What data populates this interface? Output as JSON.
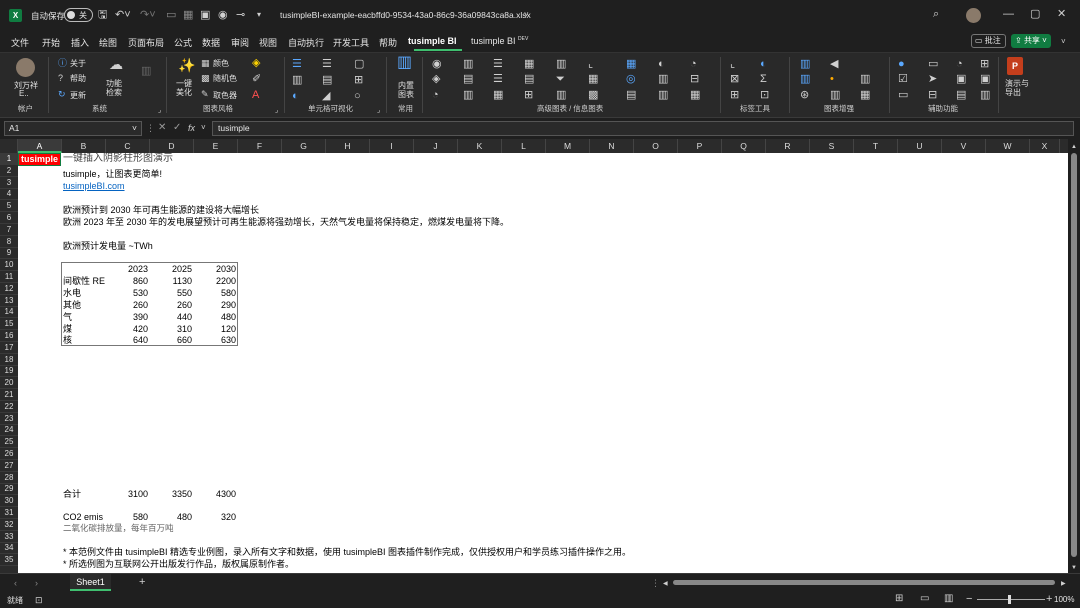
{
  "titlebar": {
    "autosave": "自动保存",
    "autosave_state": "关",
    "filename": "tusimpleBI-example-eacbffd0-9534-43a0-86c9-36a09843ca8a.xlsx"
  },
  "tabs": [
    "文件",
    "开始",
    "插入",
    "绘图",
    "页面布局",
    "公式",
    "数据",
    "审阅",
    "视图",
    "自动执行",
    "开发工具",
    "帮助",
    "tusimple BI",
    "tusimple BI"
  ],
  "tab_dev_badge": "DEV",
  "right_buttons": {
    "comments": "批注",
    "share": "共享"
  },
  "ribbon": {
    "account": {
      "user": "刘万祥",
      "user2": "E..",
      "group": "帐户"
    },
    "system": {
      "about": "关于",
      "help": "帮助",
      "update": "更新",
      "func": "功能",
      "func2": "检索",
      "group": "系统"
    },
    "style": {
      "beautify": "一键",
      "beautify2": "美化",
      "color": "颜色",
      "random": "随机色",
      "pick": "取色器",
      "group": "图表风格"
    },
    "cellviz": {
      "group": "单元格可视化"
    },
    "common": {
      "builtin": "内置",
      "builtin2": "图表",
      "group": "常用"
    },
    "advanced": {
      "group": "高级图表 / 信息图表"
    },
    "label": {
      "group": "标签工具"
    },
    "enhance": {
      "group": "图表增强"
    },
    "assist": {
      "group": "辅助功能"
    },
    "ppt": {
      "label": "演示与",
      "label2": "导出"
    }
  },
  "formula": {
    "namebox": "A1",
    "fx": "fx",
    "value": "tusimple"
  },
  "columns": [
    "A",
    "B",
    "C",
    "D",
    "E",
    "F",
    "G",
    "H",
    "I",
    "J",
    "K",
    "L",
    "M",
    "N",
    "O",
    "P",
    "Q",
    "R",
    "S",
    "T",
    "U",
    "V",
    "W",
    "X"
  ],
  "rows": [
    "1",
    "2",
    "3",
    "4",
    "5",
    "6",
    "7",
    "8",
    "9",
    "10",
    "11",
    "12",
    "13",
    "14",
    "15",
    "16",
    "17",
    "18",
    "19",
    "20",
    "21",
    "22",
    "23",
    "24",
    "25",
    "26",
    "27",
    "28",
    "29",
    "30",
    "31",
    "32",
    "33",
    "34",
    "35"
  ],
  "sheet": {
    "a1": "tusimple",
    "title": "一键插入阴影柱形图演示",
    "tagline": "tusimple，让图表更简单!",
    "link": "tusimpleBI.com",
    "line5": "欧洲预计到 2030 年可再生能源的建设将大幅增长",
    "line6": "欧洲 2023 年至 2030 年的发电展望预计可再生能源将强劲增长，天然气发电量将保持稳定，燃煤发电量将下降。",
    "line8": "欧洲预计发电量 ~TWh",
    "table": {
      "headers": [
        "2023",
        "2025",
        "2030"
      ],
      "rows": [
        {
          "name": "间歇性 RE",
          "v": [
            "860",
            "1130",
            "2200"
          ]
        },
        {
          "name": "水电",
          "v": [
            "530",
            "550",
            "580"
          ]
        },
        {
          "name": "其他",
          "v": [
            "260",
            "260",
            "290"
          ]
        },
        {
          "name": "气",
          "v": [
            "390",
            "440",
            "480"
          ]
        },
        {
          "name": "煤",
          "v": [
            "420",
            "310",
            "120"
          ]
        },
        {
          "name": "核",
          "v": [
            "640",
            "660",
            "630"
          ]
        }
      ]
    },
    "total": {
      "name": "合计",
      "v": [
        "3100",
        "3350",
        "4300"
      ]
    },
    "co2": {
      "name": "CO2 emis",
      "v": [
        "580",
        "480",
        "320"
      ]
    },
    "co2_note": "二氧化碳排放量，每年百万吨",
    "note1": "* 本范例文件由 tusimpleBI 精选专业例图，录入所有文字和数据，使用 tusimpleBI 图表插件制作完成，仅供授权用户和学员练习插件操作之用。",
    "note2": "* 所选例图为互联网公开出版发行作品，版权属原制作者。"
  },
  "sheettab": "Sheet1",
  "status": {
    "ready": "就绪",
    "zoom": "100%"
  },
  "colors": {
    "accent": "#107c41",
    "a1_bg": "#ff0000",
    "link": "#0563c1"
  }
}
